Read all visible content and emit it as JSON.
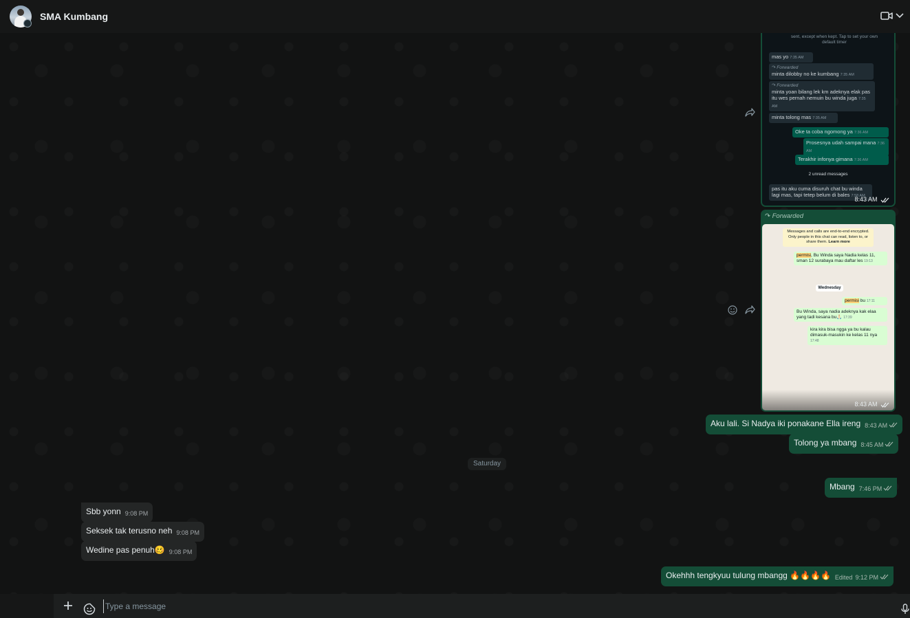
{
  "header": {
    "chat_name": "SMA Kumbang",
    "icons": [
      "avatar",
      "video-call-icon",
      "chevron-down-icon"
    ]
  },
  "screenshot1": {
    "top_text": "sent, except when kept. Tap to set your own default timer",
    "messages": [
      {
        "dir": "in",
        "text": "mas yo",
        "time": "7:35 AM"
      },
      {
        "dir": "in",
        "forwarded": "Forwarded",
        "text": "minta dilobby no ke kumbang",
        "time": "7:35 AM"
      },
      {
        "dir": "in",
        "forwarded": "Forwarded",
        "text": "minta yoan bilang lek km adeknya elak pas itu wes pernah nemuin bu winda juga",
        "time": "7:35 AM"
      },
      {
        "dir": "in",
        "text": "minta tolong mas",
        "time": "7:35 AM"
      },
      {
        "dir": "out",
        "text": "Oke ta coba ngomong ya",
        "time": "7:36 AM"
      },
      {
        "dir": "out",
        "text": "Prosesnya udah sampai mana",
        "time": "7:36 AM"
      },
      {
        "dir": "out",
        "text": "Terakhir infonya gimana",
        "time": "7:36 AM"
      },
      {
        "dir": "in",
        "text": "pas itu aku cuma disuruh chat bu winda lagi mas, tapi tetep belum di bales",
        "time": "7:58 AM"
      }
    ],
    "unread": "2 unread messages",
    "time": "8:43 AM"
  },
  "screenshot2": {
    "forwarded_label": "Forwarded",
    "encryption_notice": "Messages and calls are end-to-end encrypted. Only people in this chat can read, listen to, or share them.",
    "learn_more": "Learn more",
    "day": "Wednesday",
    "messages": [
      {
        "highlight": "permisi",
        "text": ", Bu Winda saya Nadia kelas 11, sman 12 surabaya mau daftar les",
        "time": "19:13"
      },
      {
        "highlight": "permisi",
        "text": " bu",
        "time": "17:11"
      },
      {
        "text": "Bu Winda, saya nadia adeknya kak elaa yang tadi kesana bu🙏🏻",
        "time": "17:39"
      },
      {
        "text": "kira kira bisa ngga ya bu kalau dimasuk-masukin ke kelas 11 nya",
        "time": "17:48"
      }
    ],
    "time": "8:43 AM"
  },
  "messages": [
    {
      "id": "m1",
      "dir": "out",
      "text": "Aku lali. Si Nadya iki ponakane Ella ireng",
      "time": "8:43 AM"
    },
    {
      "id": "m2",
      "dir": "out",
      "text": "Tolong ya mbang",
      "time": "8:45 AM"
    },
    {
      "id": "m3",
      "dir": "out",
      "text": "Mbang",
      "time": "7:46 PM"
    },
    {
      "id": "m4",
      "dir": "in",
      "text": "Sbb yonn",
      "time": "9:08 PM"
    },
    {
      "id": "m5",
      "dir": "in",
      "text": "Seksek tak terusno neh",
      "time": "9:08 PM"
    },
    {
      "id": "m6",
      "dir": "in",
      "text": "Wedine pas penuh🥴",
      "time": "9:08 PM"
    },
    {
      "id": "m7",
      "dir": "out",
      "text": "Okehhh tengkyuu tulung mbangg 🔥🔥🔥🔥",
      "edited": "Edited",
      "time": "9:12 PM"
    }
  ],
  "date_separator": "Saturday",
  "composer": {
    "placeholder": "Type a message"
  }
}
